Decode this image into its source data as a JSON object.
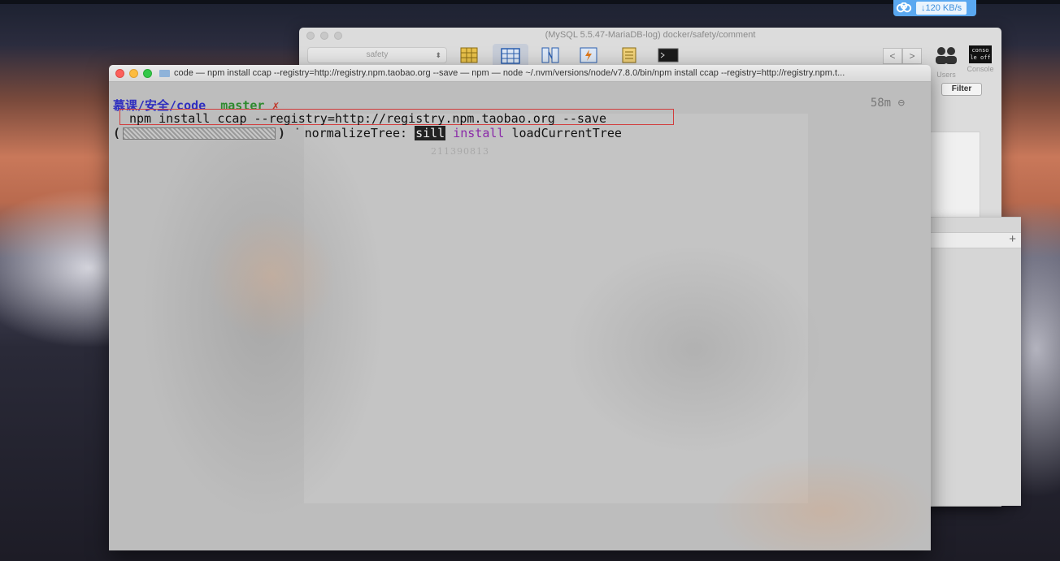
{
  "netspeed": {
    "icon": "baidu-cloud-icon",
    "speed": "↓120 KB/s"
  },
  "back_window": {
    "title": "(MySQL 5.5.47-MariaDB-log) docker/safety/comment",
    "database": "safety",
    "users_label": "Users",
    "console_label": "Console",
    "console_icon_text": "conso le off",
    "filter_label": "Filter",
    "nav_back": "<",
    "nav_forward": ">"
  },
  "third_window": {
    "plus": "+"
  },
  "terminal": {
    "title": "code — npm install ccap --registry=http://registry.npm.taobao.org --save — npm — node ~/.nvm/versions/node/v7.8.0/bin/npm install ccap --registry=http://registry.npm.t...",
    "prompt_path": "慕课/安全/code",
    "prompt_branch": "master",
    "prompt_dirty": "✗",
    "elapsed": "58m",
    "elapsed_icon": "⊖",
    "command": "npm install ccap --registry=http://registry.npm.taobao.org --save",
    "progress_open": "(",
    "progress_close": ")",
    "progress_spinner": "⠈",
    "progress_stage": "normalizeTree:",
    "progress_level": "sill",
    "progress_action": "install",
    "progress_detail": "loadCurrentTree",
    "ghost_text": "211390813"
  }
}
